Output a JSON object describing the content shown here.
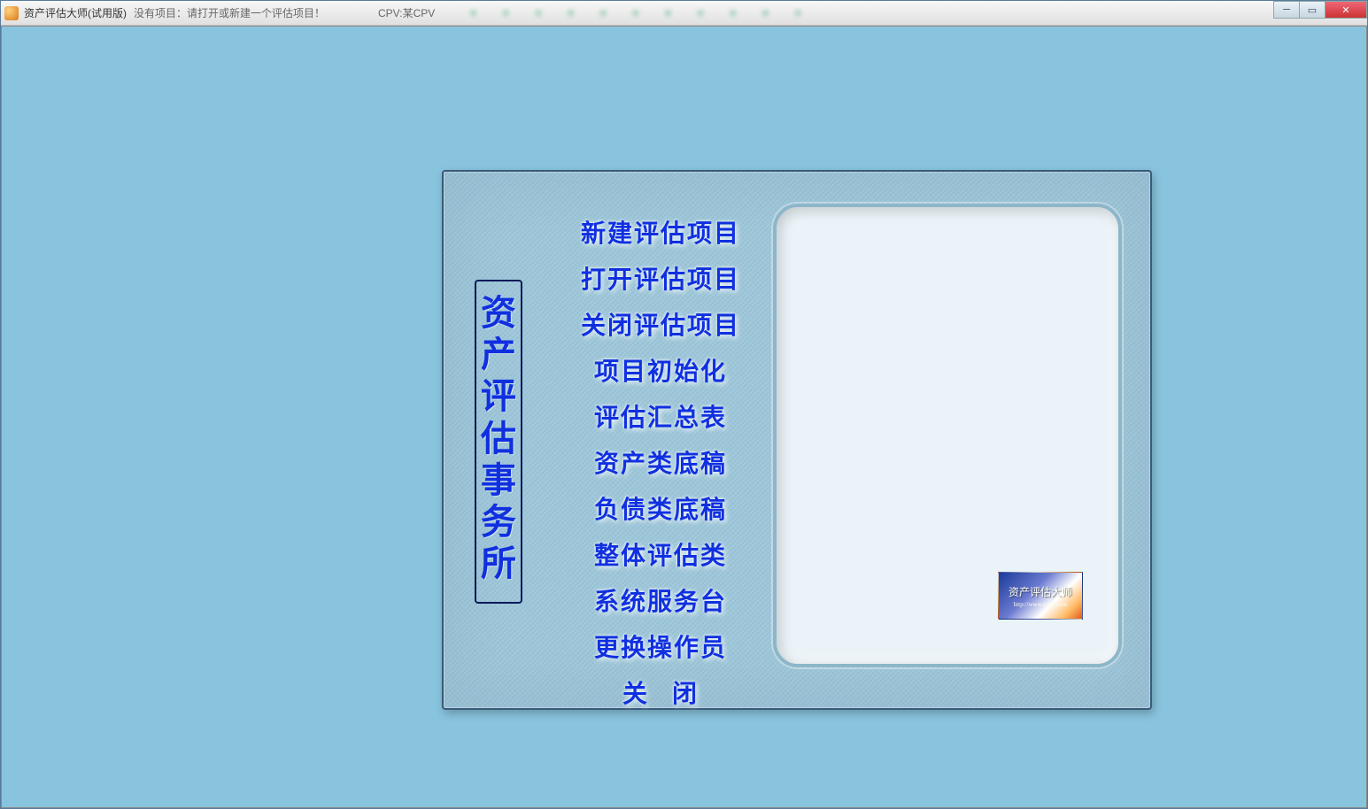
{
  "titlebar": {
    "app_name": "资产评估大师(试用版)",
    "project_hint": "没有项目：请打开或新建一个评估项目！",
    "cpv_label": "CPV:某CPV"
  },
  "vertical_title": [
    "资",
    "产",
    "评",
    "估",
    "事",
    "务",
    "所"
  ],
  "menu": {
    "items": [
      "新建评估项目",
      "打开评估项目",
      "关闭评估项目",
      "项目初始化",
      "评估汇总表",
      "资产类底稿",
      "负债类底稿",
      "整体评估类",
      "系统服务台",
      "更换操作员",
      "关闭"
    ]
  },
  "brand": {
    "text": "资产评估大师",
    "url": "http://www.cpv8.com"
  }
}
